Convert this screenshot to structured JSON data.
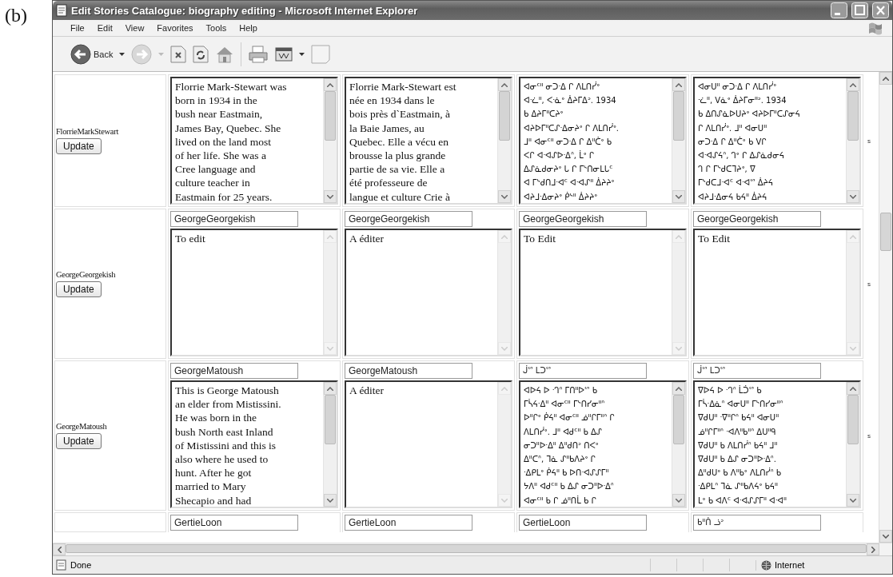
{
  "figure_label": "(b)",
  "window": {
    "title": "Edit Stories Catalogue: biography editing - Microsoft Internet Explorer"
  },
  "menu": [
    "File",
    "Edit",
    "View",
    "Favorites",
    "Tools",
    "Help"
  ],
  "toolbar": {
    "back_label": "Back"
  },
  "rows": [
    {
      "label": "FlorrieMarkStewart",
      "button": "Update",
      "column_6": "s",
      "fields": [
        {
          "kind": "latin",
          "scrollable": true,
          "text": "Florrie Mark-Stewart was\nborn in 1934 in the\nbush near Eastmain,\nJames Bay, Quebec. She\nlived on the land most\nof her life. She was a\nCree language and\nculture teacher in\nEastmain for 25 years."
        },
        {
          "kind": "latin",
          "scrollable": true,
          "text": "Florrie Mark-Stewart est\nnée en 1934 dans le\nbois près d`Eastmain, à\nla Baie James, au\nQuebec. Elle a vécu en\nbrousse la plus grande\npartie de sa vie. Elle a\nété professeure de\nlangue et culture Crie à"
        },
        {
          "kind": "syllabics",
          "scrollable": true,
          "text": "ᐊᓂᑦᐦ ᓂᑐᐧᐃ ᒋ ᐱᒪᑎᓰᐤ\nᐊᐧᓛᐦ, ᐸᐧᓈᐤ ᐄᔨᒥᐃᐣ. 1934\nᑲ ᐃᔨᒥᐦᑕᔨᐤ\nᐊᔨᐅᒥᐦᑕᔑᐧᐃᓂᔨᐤ ᒋ ᐱᒪᑎᓰᐤ.\nᒧᐦ ᐊᓂᑦᐦ ᓂᑐᐧᐃ ᒋ ᐃᐦᑖᐤ ᑲ\nᐸᒋ ᐊᐧᐊᔑᐅᐧᐃᐢ, ᒫᐤ ᒋ\nᐃᔑᓈᑯᓂᔨᐤ ᒐ ᒋ ᒥᔅᑎᓂᒪᒐᑦ\nᐊ ᒥᔅᑯᑎᒧᐧᐊᑦ ᐊᐧᐊᔑᐦ ᐄᔨᔨᐤ\nᐊᔨᒧᐧᐃᓂᔨᐤ ᑮᔅᐦ ᐄᔨᔨᐤ"
        },
        {
          "kind": "syllabics",
          "scrollable": true,
          "text": "ᐊᓂᑌᐦ ᓂᑐᐧᐃ ᒋ ᐱᒪᑎᓰᐤ\nᐧᓛᐦ, ᐯᓈᐤ ᐄᔨᒥᓂᐦᐣ. 1934\nᑲ ᐃᑎᔑᓈᐅᑌᔨᐤ ᐊᔨᐅᒥᐦᑕᔑᓂᔦ\nᒋ ᐱᒪᑎᓰᐤ. ᒧᐦ ᐊᓂᑌᐦ\nᓂᑐᐧᐃ ᒋ ᐃᐦᑖᐤ ᑲ ᐯᒋ\nᐊᐧᐊᔑᔦᐢ, ᒉᐤ ᒋ ᐃᔑᓈᑯᓂᔦ\nᒉ ᒋ ᒥᔅᑯᑕᒣᔨᐤ, ᐁ\nᒥᔅᑯᑕᒧᐧᐊᑦ ᐊᐧᐊᔥ ᐄᔨᔦ\nᐊᔨᒧᐧᐃᓂᔦ ᑲᔦᐦ ᐄᔨᔦ"
        }
      ]
    },
    {
      "label": "GeorgeGeorgekish",
      "button": "Update",
      "column_6": "s",
      "fields": [
        {
          "kind": "latin",
          "name": "GeorgeGeorgekish",
          "scrollable": false,
          "text": "To edit"
        },
        {
          "kind": "latin",
          "name": "GeorgeGeorgekish",
          "scrollable": false,
          "text": "A éditer"
        },
        {
          "kind": "latin",
          "name": "GeorgeGeorgekish",
          "scrollable": false,
          "text": "To Edit"
        },
        {
          "kind": "latin",
          "name": "GeorgeGeorgekish",
          "scrollable": false,
          "text": "To Edit"
        }
      ]
    },
    {
      "label": "GeorgeMatoush",
      "button": "Update",
      "column_6": "s",
      "fields": [
        {
          "kind": "latin",
          "name": "GeorgeMatoush",
          "scrollable": true,
          "text": "This is George Matoush\nan elder from Mistissini.\nHe was born in the\nbush North east Inland\nof Mistissini and this is\nalso where he used to\nhunt. After he got\nmarried to Mary\nShecapio and had"
        },
        {
          "kind": "latin",
          "name": "GeorgeMatoush",
          "scrollable": false,
          "text": "A éditer"
        },
        {
          "kind": "syllabics",
          "name": "ᒎᔥ ᒪᑐᔥ",
          "scrollable": true,
          "text": "ᐊᐅᔦ ᐅ ᐧᒉᐢ ᒥᑎᐦᐅᔥ ᑲ\nᒥᓵᔦᐧᐃᐦ ᐊᓂᑦᐦ ᒥᔅᑎᓯᓂᐦᐢ\nᐅᐦᒋᐤ ᑮᔦᐦ ᐊᓂᑦᐦ ᓅᐦᒋᒥᐦᐢ ᒋ\nᐱᒪᑎᓰᐤ. ᒧᐦ ᐊᑯᑦᐦ ᑲ ᐃᔑ\nᓂᑐᐦᐅᐧᐃᐦ ᐃᐦᑯᑎᐣ ᑎᐸᐤ\nᐃᐦᑕᐢ, ᒣᓈ ᔑᐦᑲᐱᔨᐤ ᒋ\nᐧᐃᑭᒪᐤ ᑮᔦᐦ ᑲ ᐅᑎᐧᐊᔑᔑᒥᐦ\nᔭᐱᐦ ᐊᑯᑦᐦ ᑲ ᐃᔑ ᓂᑐᐦᐅᐧᐃᐢ\nᐊᓂᑦᐦ ᑲ ᒋ ᓅᐦᑎᒫ ᑲ ᒋ"
        },
        {
          "kind": "syllabics",
          "name": "ᒎᔥ ᒪᑐᔥ",
          "scrollable": true,
          "text": "ᐁᐅᔦ ᐅ ᐧᒉᐢ ᒫᑑᔥ ᑲ\nᒥᓵᐧᐃᓈᐢ ᐊᓂᑌᐦ ᒥᔅᑎᓯᓂᐦᐢ\nᐁᑯᑌᐦ ᐧᐁᐦᒋᐢ ᑲᔦᐦ ᐊᓂᑌᐦ\nᓅᐦᒋᒥᐦᐢ ᐧᐊᐱᐦᑲᐦᐢ ᐃᑌᐦᑫ\nᐁᑯᑌᐦ ᑲ ᐱᒪᑎᓰᐢ ᑲᔦᐦ ᒧᐦ\nᐁᑯᑌᐦ ᑲ ᐃᔑ ᓂᑐᐦᐅᐧᐃᐢ.\nᐃᐦᑯᑌᐤ ᑲ ᐱᐦᑲᐤ ᐱᒪᑎᓰᐢ ᑲ\nᐧᐃᑭᒪᐢ ᒣᓈ ᔑᐦᑲᐱᔦᐤ ᑲᔦᐦ\nᒪᐤ ᑲ ᐊᐱᑦ ᐊᐧᐊᔑᔑᒥᐦ ᐊᐧᐊᐦ"
        }
      ]
    },
    {
      "fields": [
        {
          "kind": "latin",
          "name": "GertieLoon"
        },
        {
          "kind": "latin",
          "name": "GertieLoon"
        },
        {
          "kind": "latin",
          "name": "GertieLoon"
        },
        {
          "kind": "syllabics",
          "name": "ᑲᐦᑏ ᓘᐣ"
        }
      ]
    }
  ],
  "status_bar": {
    "status": "Done",
    "zone": "Internet"
  }
}
